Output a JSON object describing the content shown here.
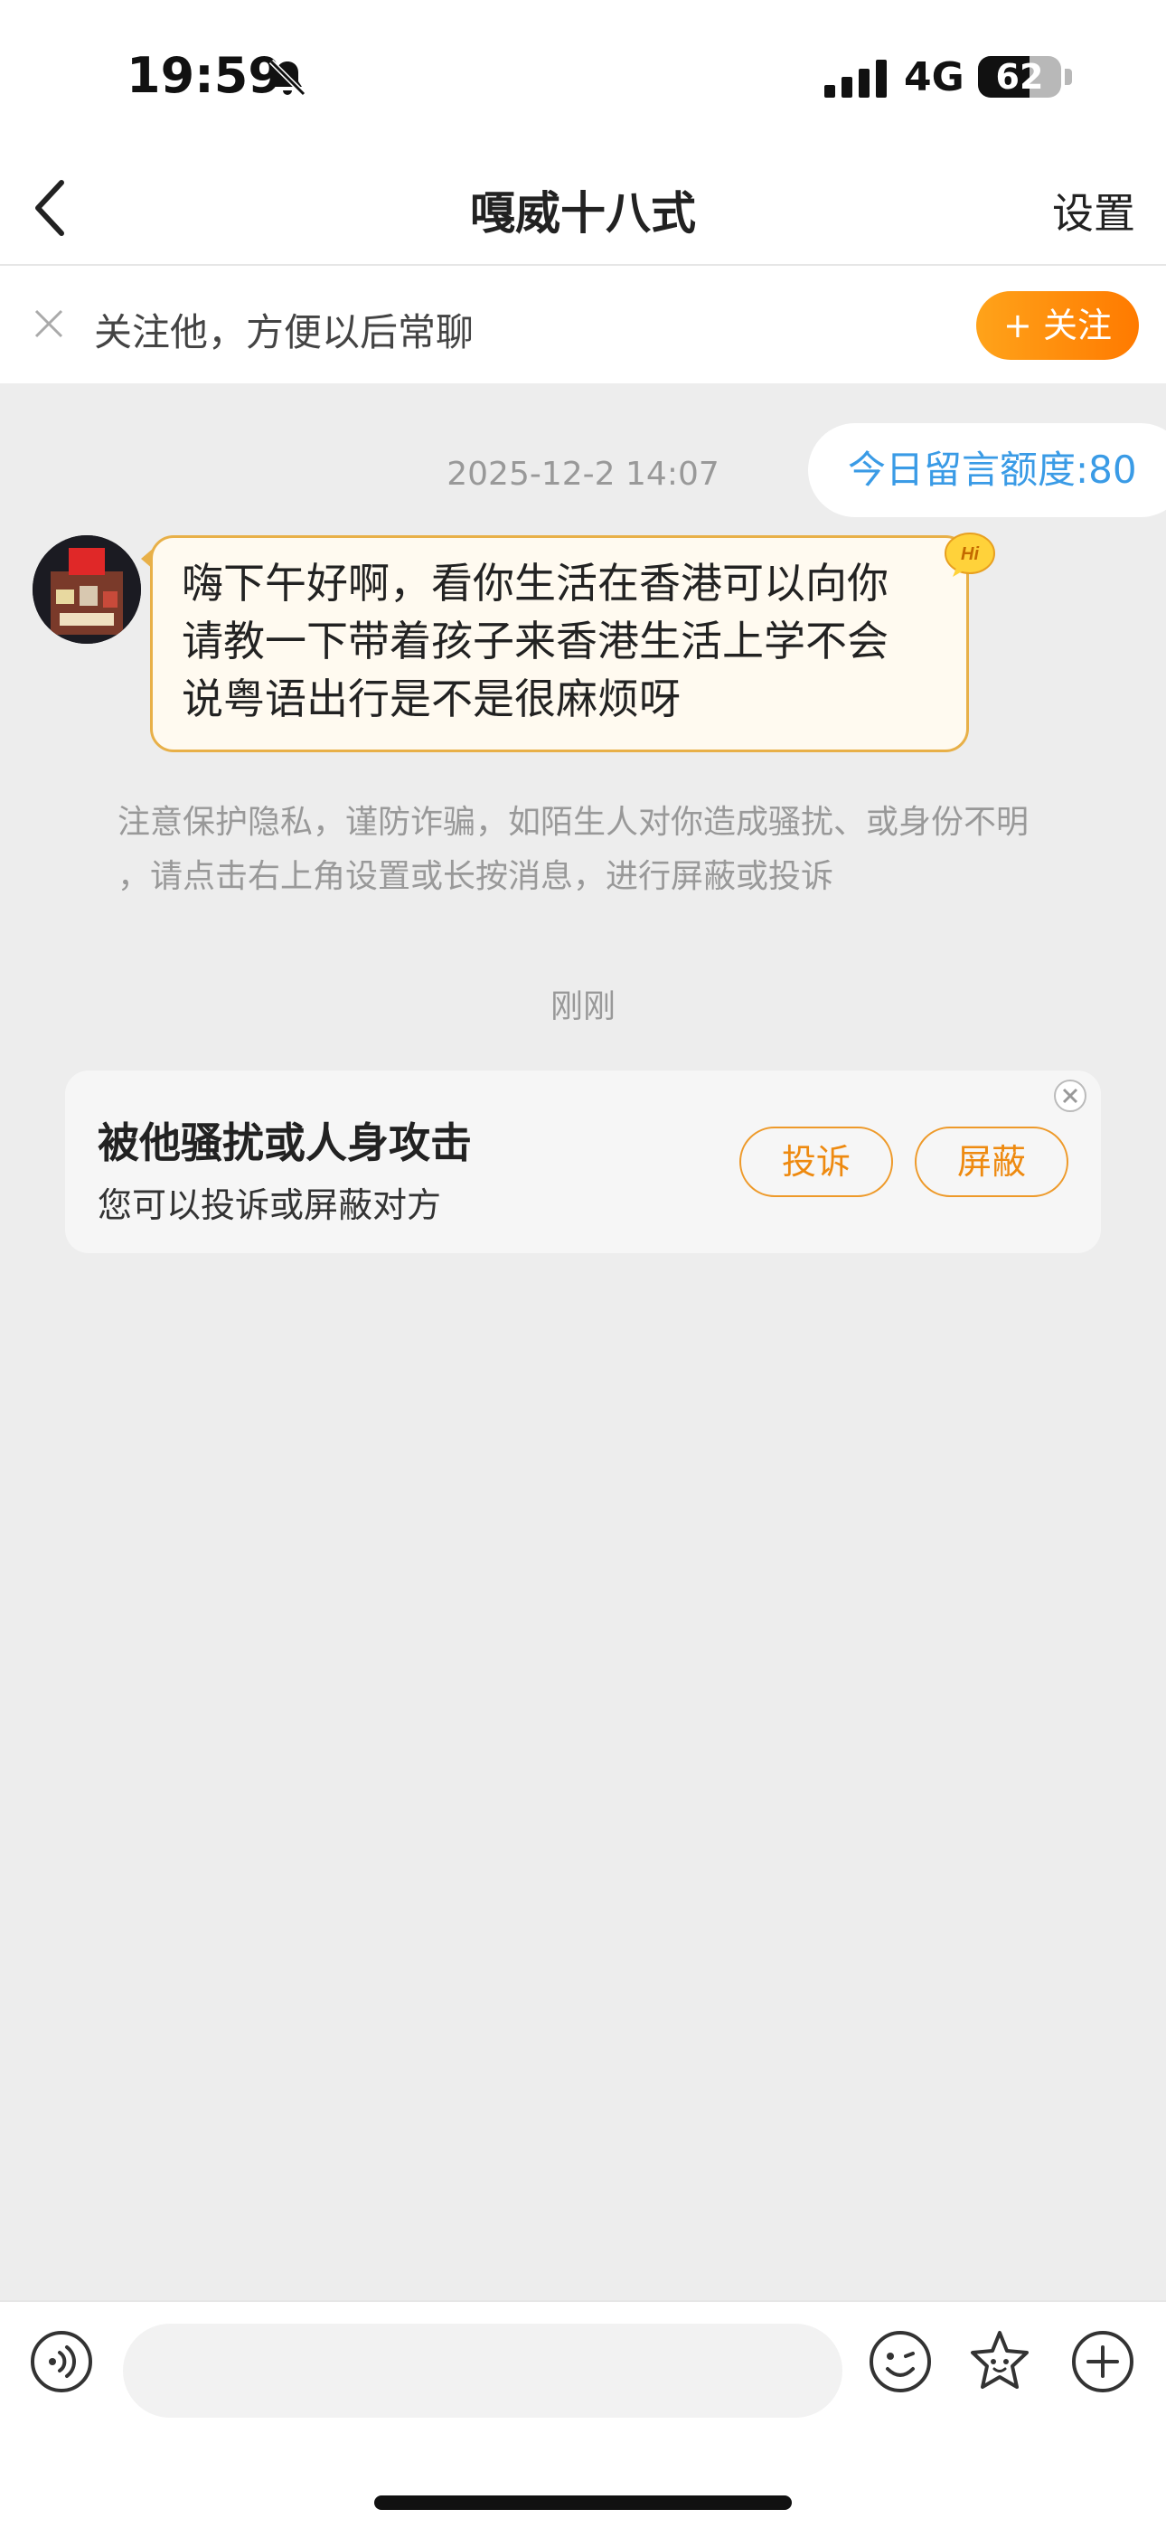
{
  "status_bar": {
    "time": "19:59",
    "network": "4G",
    "battery_percent": 62,
    "battery_label": "62"
  },
  "nav": {
    "title": "嘎威十八式",
    "settings_label": "设置"
  },
  "follow_banner": {
    "text": "关注他，方便以后常聊",
    "button_label": "+ 关注"
  },
  "chat": {
    "quota_label": "今日留言额度:80",
    "timestamp": "2025-12-2 14:07",
    "message_lines": [
      "嗨下午好啊，看你生活在香港可以向你",
      "请教一下带着孩子来香港生活上学不会",
      "说粤语出行是不是很麻烦呀"
    ],
    "hi_badge": "Hi",
    "safety_note_lines": [
      "注意保护隐私，谨防诈骗，如陌生人对你造成骚扰、或身份不明",
      "，请点击右上角设置或长按消息，进行屏蔽或投诉"
    ],
    "just_now": "刚刚",
    "harass_card": {
      "title": "被他骚扰或人身攻击",
      "subtitle": "您可以投诉或屏蔽对方",
      "complain_label": "投诉",
      "block_label": "屏蔽"
    }
  },
  "input_bar": {
    "placeholder": ""
  },
  "colors": {
    "accent_orange": "#ff8a00",
    "quota_blue": "#3a9be6",
    "chat_bg": "#ededed",
    "bubble_border": "#e8b048"
  },
  "icons": [
    "bell-slash-icon",
    "signal-icon",
    "back-icon",
    "close-icon",
    "hi-badge-icon",
    "voice-icon",
    "emoji-icon",
    "sticker-icon",
    "plus-icon"
  ]
}
